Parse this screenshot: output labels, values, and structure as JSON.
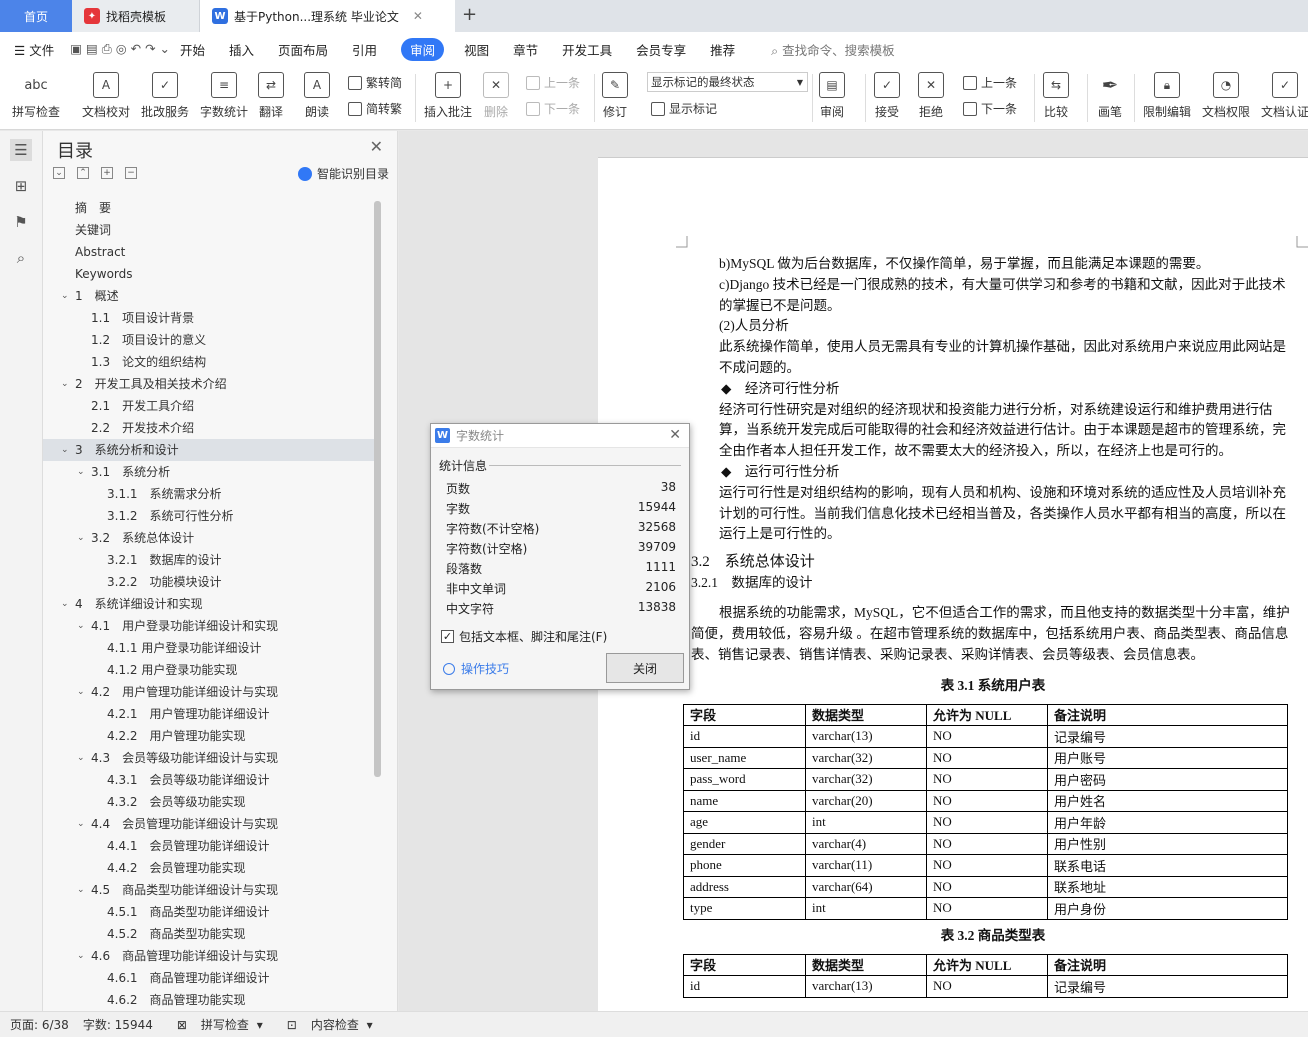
{
  "tabs": {
    "home": "首页",
    "template": "找稻壳模板",
    "doc": "基于Python...理系统 毕业论文"
  },
  "menu": {
    "file": "文件",
    "items": [
      "开始",
      "插入",
      "页面布局",
      "引用",
      "审阅",
      "视图",
      "章节",
      "开发工具",
      "会员专享",
      "推荐"
    ],
    "search": "查找命令、搜索模板"
  },
  "ribbon": {
    "spell": "拼写检查",
    "doc_proof": "文档校对",
    "batch": "批改服务",
    "word_count": "字数统计",
    "translate": "翻译",
    "read": "朗读",
    "trad": "繁转简",
    "simp": "简转繁",
    "insert_comment": "插入批注",
    "delete": "删除",
    "prev": "上一条",
    "next": "下一条",
    "track": "修订",
    "markup_state": "显示标记的最终状态",
    "show_markup": "显示标记",
    "review": "审阅",
    "accept": "接受",
    "reject": "拒绝",
    "prev2": "上一条",
    "next2": "下一条",
    "compare": "比较",
    "pen": "画笔",
    "restrict": "限制编辑",
    "perm": "文档权限",
    "cert": "文档认证"
  },
  "toc": {
    "title": "目录",
    "smart": "智能识别目录",
    "entries": [
      {
        "t": "摘　要",
        "l": 0
      },
      {
        "t": "关键词",
        "l": 0
      },
      {
        "t": "Abstract",
        "l": 0
      },
      {
        "t": "Keywords",
        "l": 0
      },
      {
        "t": "1　概述",
        "l": 1
      },
      {
        "t": "1.1　项目设计背景",
        "l": 2
      },
      {
        "t": "1.2　项目设计的意义",
        "l": 2
      },
      {
        "t": "1.3　论文的组织结构",
        "l": 2
      },
      {
        "t": "2　开发工具及相关技术介绍",
        "l": 1
      },
      {
        "t": "2.1　开发工具介绍",
        "l": 2
      },
      {
        "t": "2.2　开发技术介绍",
        "l": 2
      },
      {
        "t": "3　系统分析和设计",
        "l": 1,
        "sel": true
      },
      {
        "t": "3.1　系统分析",
        "l": 3
      },
      {
        "t": "3.1.1　系统需求分析",
        "l": 4
      },
      {
        "t": "3.1.2　系统可行性分析",
        "l": 4
      },
      {
        "t": "3.2　系统总体设计",
        "l": 3
      },
      {
        "t": "3.2.1　数据库的设计",
        "l": 4
      },
      {
        "t": "3.2.2　功能模块设计",
        "l": 4
      },
      {
        "t": "4　系统详细设计和实现",
        "l": 1
      },
      {
        "t": "4.1　用户登录功能详细设计和实现",
        "l": 3
      },
      {
        "t": "4.1.1 用户登录功能详细设计",
        "l": 4
      },
      {
        "t": "4.1.2 用户登录功能实现",
        "l": 4
      },
      {
        "t": "4.2　用户管理功能详细设计与实现",
        "l": 3
      },
      {
        "t": "4.2.1　用户管理功能详细设计",
        "l": 4
      },
      {
        "t": "4.2.2　用户管理功能实现",
        "l": 4
      },
      {
        "t": "4.3　会员等级功能详细设计与实现",
        "l": 3
      },
      {
        "t": "4.3.1　会员等级功能详细设计",
        "l": 4
      },
      {
        "t": "4.3.2　会员等级功能实现",
        "l": 4
      },
      {
        "t": "4.4　会员管理功能详细设计与实现",
        "l": 3
      },
      {
        "t": "4.4.1　会员管理功能详细设计",
        "l": 4
      },
      {
        "t": "4.4.2　会员管理功能实现",
        "l": 4
      },
      {
        "t": "4.5　商品类型功能详细设计与实现",
        "l": 3
      },
      {
        "t": "4.5.1　商品类型功能详细设计",
        "l": 4
      },
      {
        "t": "4.5.2　商品类型功能实现",
        "l": 4
      },
      {
        "t": "4.6　商品管理功能详细设计与实现",
        "l": 3
      },
      {
        "t": "4.6.1　商品管理功能详细设计",
        "l": 4
      },
      {
        "t": "4.6.2　商品管理功能实现",
        "l": 4
      }
    ]
  },
  "document": {
    "p1": "b)MySQL 做为后台数据库，不仅操作简单，易于掌握，而且能满足本课题的需要。",
    "p2": "c)Django 技术已经是一门很成熟的技术，有大量可供学习和参考的书籍和文献，因此对于此技术的掌握已不是问题。",
    "p3": "(2)人员分析",
    "p4": "此系统操作简单，使用人员无需具有专业的计算机操作基础，因此对系统用户来说应用此网站是不成问题的。",
    "p5": "◆　经济可行性分析",
    "p6": "经济可行性研究是对组织的经济现状和投资能力进行分析，对系统建设运行和维护费用进行估算，当系统开发完成后可能取得的社会和经济效益进行估计。由于本课题是超市的管理系统，完全由作者本人担任开发工作，故不需要太大的经济投入，所以，在经济上也是可行的。",
    "p7": "◆　运行可行性分析",
    "p8": "运行可行性是对组织结构的影响，现有人员和机构、设施和环境对系统的适应性及人员培训补充计划的可行性。当前我们信息化技术已经相当普及，各类操作人员水平都有相当的高度，所以在运行上是可行性的。",
    "h2": "3.2　系统总体设计",
    "h3": "3.2.1　数据库的设计",
    "p9": "根据系统的功能需求，MySQL，它不但适合工作的需求，而且他支持的数据类型十分丰富，维护简便，费用较低，容易升级 。在超市管理系统的数据库中，包括系统用户表、商品类型表、商品信息表、销售记录表、销售详情表、采购记录表、采购详情表、会员等级表、会员信息表。",
    "cap1": "表 3.1 系统用户表",
    "cap2": "表 3.2 商品类型表",
    "headers": [
      "字段",
      "数据类型",
      "允许为 NULL",
      "备注说明"
    ],
    "rows1": [
      [
        "id",
        "varchar(13)",
        "NO",
        "记录编号"
      ],
      [
        "user_name",
        "varchar(32)",
        "NO",
        "用户账号"
      ],
      [
        "pass_word",
        "varchar(32)",
        "NO",
        "用户密码"
      ],
      [
        "name",
        "varchar(20)",
        "NO",
        "用户姓名"
      ],
      [
        "age",
        "int",
        "NO",
        "用户年龄"
      ],
      [
        "gender",
        "varchar(4)",
        "NO",
        "用户性别"
      ],
      [
        "phone",
        "varchar(11)",
        "NO",
        "联系电话"
      ],
      [
        "address",
        "varchar(64)",
        "NO",
        "联系地址"
      ],
      [
        "type",
        "int",
        "NO",
        "用户身份"
      ]
    ],
    "rows2": [
      [
        "id",
        "varchar(13)",
        "NO",
        "记录编号"
      ]
    ]
  },
  "dialog": {
    "title": "字数统计",
    "section": "统计信息",
    "stats": [
      [
        "页数",
        "38"
      ],
      [
        "字数",
        "15944"
      ],
      [
        "字符数(不计空格)",
        "32568"
      ],
      [
        "字符数(计空格)",
        "39709"
      ],
      [
        "段落数",
        "1111"
      ],
      [
        "非中文单词",
        "2106"
      ],
      [
        "中文字符",
        "13838"
      ]
    ],
    "include": "包括文本框、脚注和尾注(F)",
    "tips": "操作技巧",
    "close": "关闭"
  },
  "status": {
    "page": "页面: 6/38",
    "words": "字数: 15944",
    "spell": "拼写检查",
    "content": "内容检查"
  }
}
